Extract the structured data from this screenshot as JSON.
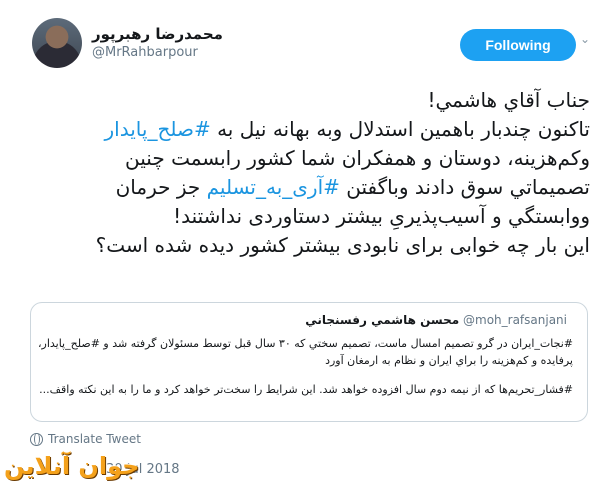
{
  "author": {
    "display_name": "محمدرضا رهبرپور",
    "handle": "@MrRahbarpour",
    "follow_label": "Following"
  },
  "tweet": {
    "lines": [
      [
        {
          "t": "جناب آقاي هاشمي!",
          "h": false
        }
      ],
      [
        {
          "t": "تاکنون چندبار باهمين استدلال وبه بهانه نيل به ",
          "h": false
        },
        {
          "t": "#صلح_پايدار",
          "h": true
        }
      ],
      [
        {
          "t": "وکم‌هزينه، دوستان و همفکران شما کشور رابسمت چنين",
          "h": false
        }
      ],
      [
        {
          "t": "تصميماتي سوق دادند وباگفتن ",
          "h": false
        },
        {
          "t": "#آری_به_تسلیم",
          "h": true
        },
        {
          "t": " جز حرمان",
          "h": false
        }
      ],
      [
        {
          "t": "ووابستگي و آسیب‌پذیریِ بیشتر دستاوردی نداشتند!",
          "h": false
        }
      ],
      [
        {
          "t": "این بار چه خوابی برای نابودی بیشتر کشور دیده شده است؟",
          "h": false
        }
      ]
    ]
  },
  "quote": {
    "name": "محسن هاشمي رفسنجاني",
    "handle": "@moh_rafsanjani",
    "lines": [
      "#نجات_ايران در گرو تصميم امسال ماست، تصميم سختي كه ۳۰ سال قبل توسط مسئولان گرفته شد و #صلح_پايدار،",
      "پرفايده و كم‌هزينه را براي ايران و نظام به ارمغان آورد",
      "#فشار_تحريم‌ها كه از نيمه دوم سال افزوده خواهد شد. اين شرايط را سخت‌تر خواهد كرد و ما را به اين نكته واقف..."
    ]
  },
  "translate_label": "Translate Tweet",
  "timestamp": "30 Jul 2018",
  "watermark": "جوان آنلاین"
}
